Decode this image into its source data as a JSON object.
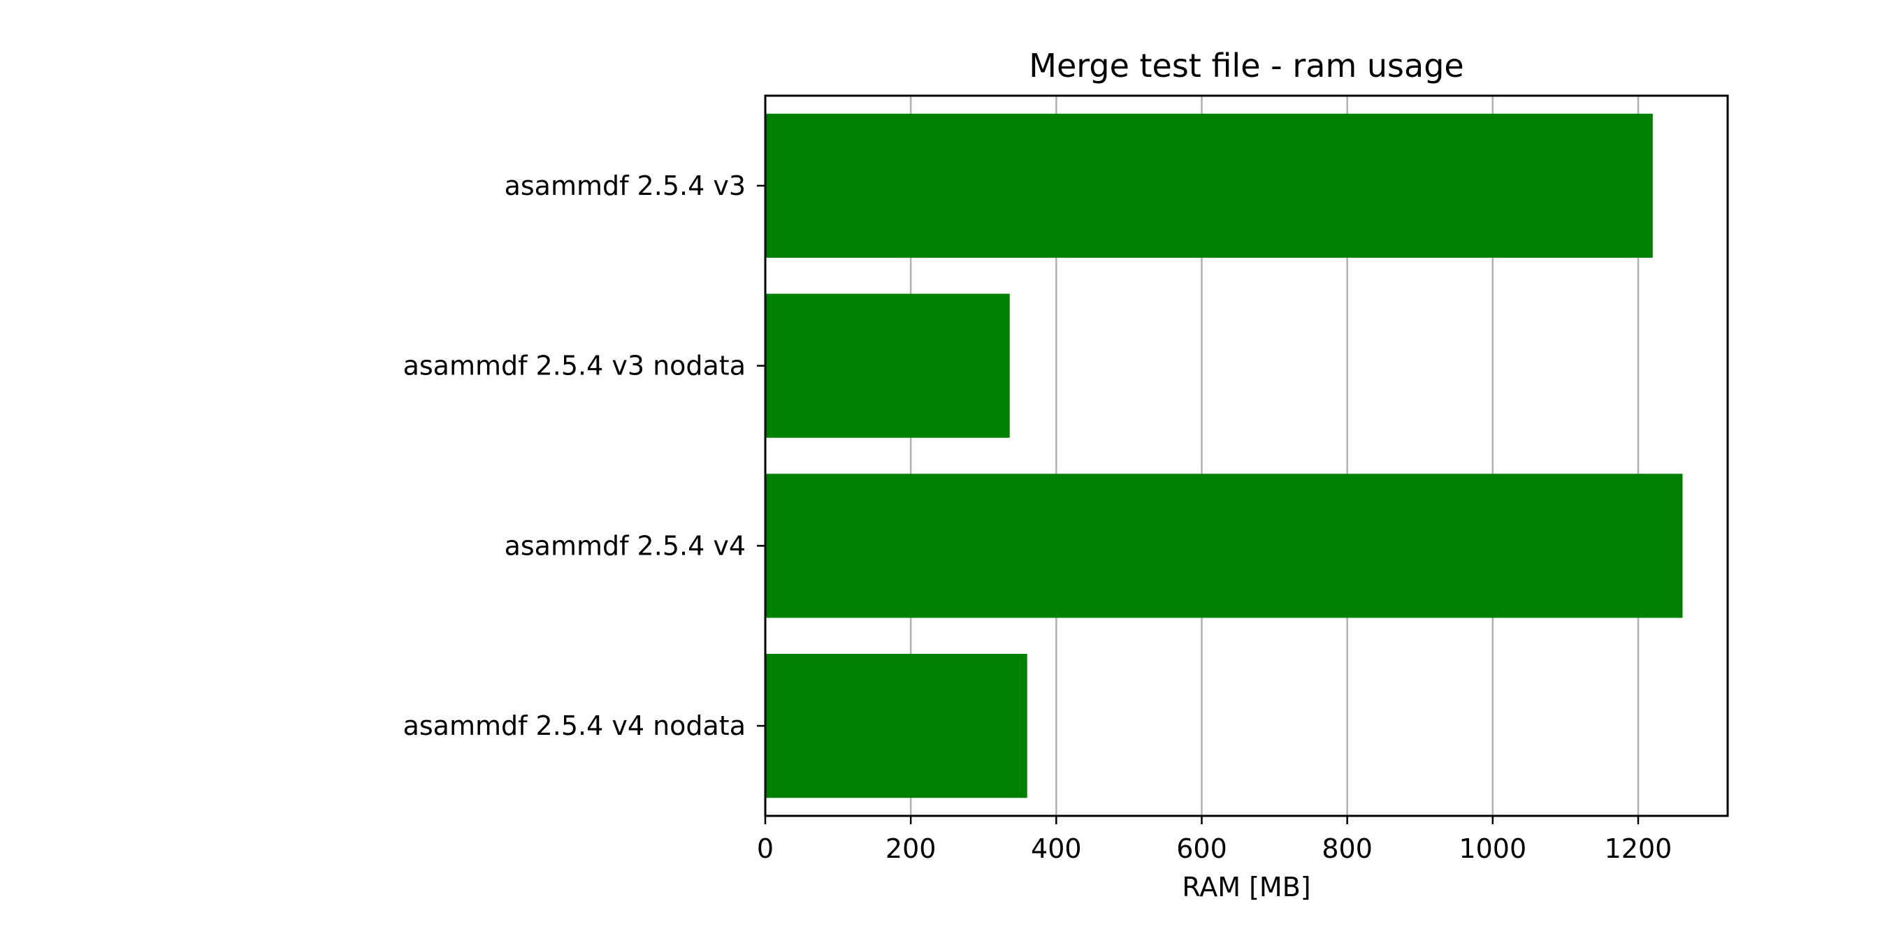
{
  "chart_data": {
    "type": "bar",
    "orientation": "horizontal",
    "title": "Merge test file - ram usage",
    "xlabel": "RAM [MB]",
    "ylabel": "",
    "categories": [
      "asammdf 2.5.4 v3",
      "asammdf 2.5.4 v3 nodata",
      "asammdf 2.5.4 v4",
      "asammdf 2.5.4 v4 nodata"
    ],
    "values": [
      1220,
      336,
      1261,
      360
    ],
    "xlim": [
      0,
      1323
    ],
    "xticks": [
      0,
      200,
      400,
      600,
      800,
      1000,
      1200
    ],
    "grid": "x-axis vertical lines",
    "legend": "none",
    "colors": {
      "bar": "#008000",
      "grid": "#b0b0b0",
      "axes": "#000000"
    }
  }
}
